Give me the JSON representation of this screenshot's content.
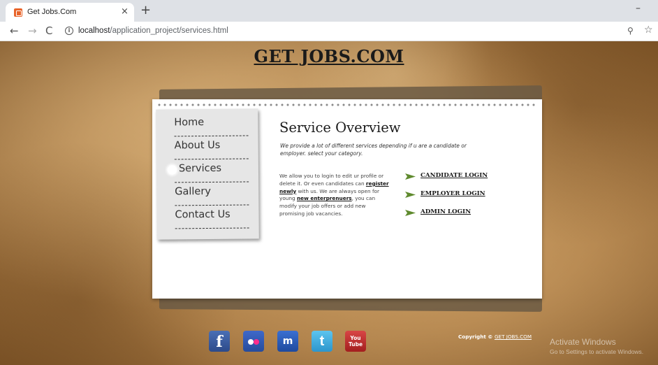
{
  "browser": {
    "tab_title": "Get Jobs.Com",
    "tab_close": "×",
    "new_tab": "+",
    "minimize": "–",
    "url_host": "localhost",
    "url_path": "/application_project/services.html",
    "icons": {
      "back": "arrow-left",
      "forward": "arrow-right",
      "reload": "reload",
      "info": "info",
      "zoom": "zoom",
      "bookmark": "star"
    }
  },
  "site": {
    "title": "GET JOBS.COM"
  },
  "nav": {
    "items": [
      {
        "label": "Home"
      },
      {
        "label": "About Us"
      },
      {
        "label": "Services"
      },
      {
        "label": "Gallery"
      },
      {
        "label": "Contact Us"
      }
    ],
    "active": "Services"
  },
  "content": {
    "title": "Service Overview",
    "intro": "We provide a lot of different services depending if u are a candidate or employer. select your category.",
    "body": {
      "text1": "We allow you to login to edit ur profile or delete it. Or even candidates can ",
      "link1": "register newly",
      "text2": " with us. We are always open for young ",
      "link2": "new enterprenuers",
      "text3": ", you can modify your job offers or add new promising job vacancies."
    },
    "logins": [
      {
        "label": "CANDIDATE LOGIN"
      },
      {
        "label": "EMPLOYER LOGIN"
      },
      {
        "label": "ADMIN LOGIN"
      }
    ]
  },
  "social": {
    "facebook": "f",
    "myspace": "m",
    "twitter": "t",
    "youtube_top": "You",
    "youtube_bottom": "Tube"
  },
  "footer": {
    "copyright_prefix": "Copyright © ",
    "copyright_link": "GET JOBS.COM"
  },
  "watermark": {
    "line1": "Activate Windows",
    "line2": "Go to Settings to activate Windows."
  },
  "colors": {
    "accent": "#5f8a2e",
    "paper": "#ffffff"
  }
}
